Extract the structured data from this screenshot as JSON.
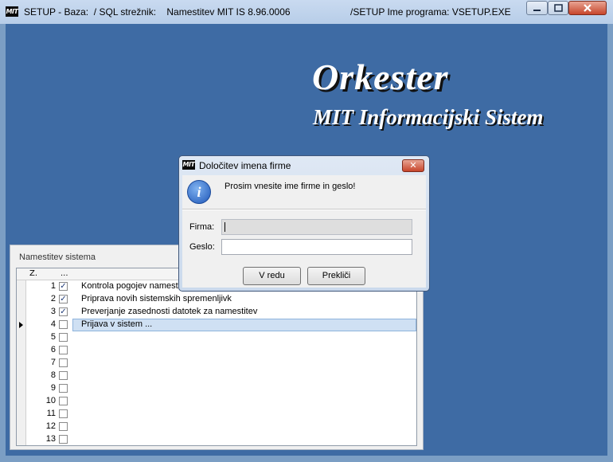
{
  "window": {
    "title": "SETUP - Baza:  / SQL strežnik:    Namestitev MIT IS 8.96.0006",
    "title_right": "/SETUP Ime programa: VSETUP.EXE",
    "app_icon_text": "MIT"
  },
  "brand": {
    "title": "Orkester",
    "subtitle": "MIT Informacijski Sistem"
  },
  "panel": {
    "title": "Namestitev sistema",
    "columns": [
      "Z.",
      "..."
    ],
    "rows": [
      {
        "num": "1",
        "checked": true,
        "check_mark": "✓",
        "desc": "Kontrola pogojev namestitve"
      },
      {
        "num": "2",
        "checked": true,
        "check_mark": "✓",
        "desc": "Priprava novih sistemskih spremenljivk"
      },
      {
        "num": "3",
        "checked": true,
        "check_mark": "✓",
        "desc": "Preverjanje zasednosti datotek za namestitev"
      },
      {
        "num": "4",
        "checked": false,
        "check_mark": "",
        "desc": "Prijava v sistem ..."
      },
      {
        "num": "5",
        "checked": false,
        "check_mark": "",
        "desc": ""
      },
      {
        "num": "6",
        "checked": false,
        "check_mark": "",
        "desc": ""
      },
      {
        "num": "7",
        "checked": false,
        "check_mark": "",
        "desc": ""
      },
      {
        "num": "8",
        "checked": false,
        "check_mark": "",
        "desc": ""
      },
      {
        "num": "9",
        "checked": false,
        "check_mark": "",
        "desc": ""
      },
      {
        "num": "10",
        "checked": false,
        "check_mark": "",
        "desc": ""
      },
      {
        "num": "11",
        "checked": false,
        "check_mark": "",
        "desc": ""
      },
      {
        "num": "12",
        "checked": false,
        "check_mark": "",
        "desc": ""
      },
      {
        "num": "13",
        "checked": false,
        "check_mark": "",
        "desc": ""
      }
    ]
  },
  "dialog": {
    "title": "Določitev imena firme",
    "icon_text": "MIT",
    "close_label": "✕",
    "info_glyph": "i",
    "message": "Prosim vnesite ime firme in geslo!",
    "firma_label": "Firma:",
    "firma_value": "",
    "geslo_label": "Geslo:",
    "geslo_value": "",
    "ok_label": "V redu",
    "cancel_label": "Prekliči"
  }
}
